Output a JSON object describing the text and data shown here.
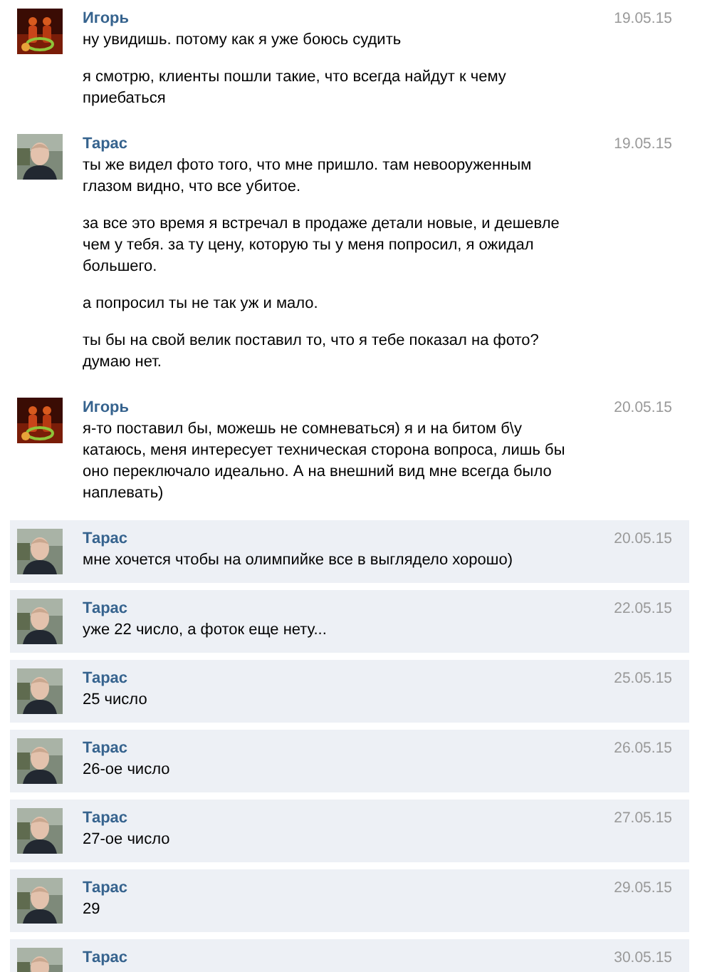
{
  "messages": [
    {
      "author": "Игорь",
      "date": "19.05.15",
      "unread": false,
      "paragraphs": [
        "ну увидишь. потому как я уже боюсь судить",
        "я смотрю, клиенты пошли такие, что всегда найдут к чему приебаться"
      ]
    },
    {
      "author": "Тарас",
      "date": "19.05.15",
      "unread": false,
      "paragraphs": [
        "ты же видел фото того, что мне пришло. там невооруженным глазом видно, что все убитое.",
        "за все это время я встречал в продаже детали новые, и дешевле чем у тебя. за ту цену, которую ты у меня попросил, я ожидал большего.",
        "а попросил ты не так уж и мало.",
        "ты бы на свой велик поставил то, что я тебе показал на фото? думаю нет."
      ]
    },
    {
      "author": "Игорь",
      "date": "20.05.15",
      "unread": false,
      "paragraphs": [
        "я-то поставил бы, можешь не сомневаться) я и на битом б\\у катаюсь, меня интересует техническая сторона вопроса, лишь бы оно переключало идеально. А на внешний вид мне всегда было наплевать)"
      ]
    },
    {
      "author": "Тарас",
      "date": "20.05.15",
      "unread": true,
      "paragraphs": [
        "мне хочется чтобы на олимпийке все в выглядело хорошо)"
      ]
    },
    {
      "author": "Тарас",
      "date": "22.05.15",
      "unread": true,
      "paragraphs": [
        "уже 22 число, а фоток еще нету..."
      ]
    },
    {
      "author": "Тарас",
      "date": "25.05.15",
      "unread": true,
      "paragraphs": [
        "25 число"
      ]
    },
    {
      "author": "Тарас",
      "date": "26.05.15",
      "unread": true,
      "paragraphs": [
        "26-ое число"
      ]
    },
    {
      "author": "Тарас",
      "date": "27.05.15",
      "unread": true,
      "paragraphs": [
        "27-ое число"
      ]
    },
    {
      "author": "Тарас",
      "date": "29.05.15",
      "unread": true,
      "paragraphs": [
        "29"
      ]
    },
    {
      "author": "Тарас",
      "date": "30.05.15",
      "unread": true
    }
  ]
}
